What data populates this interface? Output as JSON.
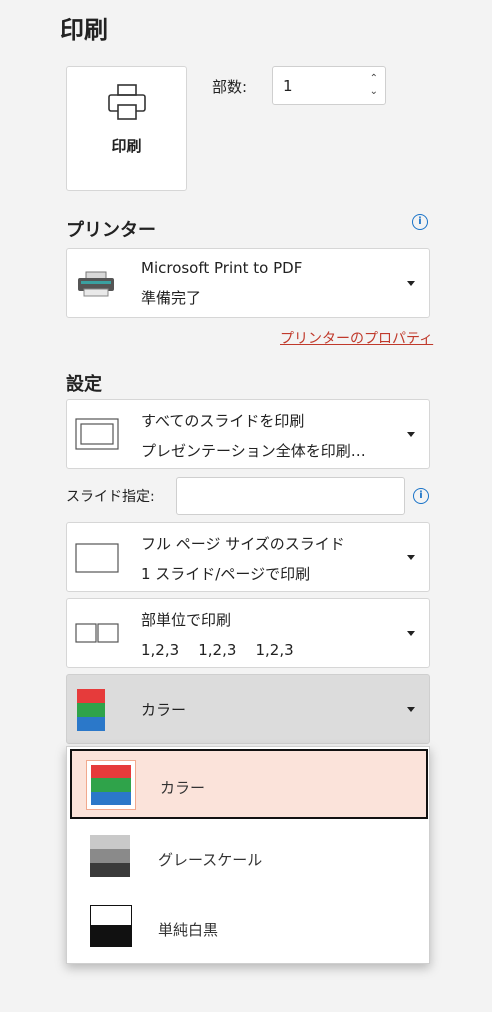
{
  "section": {
    "title": "印刷"
  },
  "print_button": {
    "label": "印刷"
  },
  "copies": {
    "label": "部数:",
    "value": "1"
  },
  "printer": {
    "heading": "プリンター",
    "name": "Microsoft Print to PDF",
    "status": "準備完了",
    "properties_link": "プリンターのプロパティ"
  },
  "settings": {
    "heading": "設定",
    "slides_range": {
      "line1": "すべてのスライドを印刷",
      "line2": "プレゼンテーション全体を印刷…"
    },
    "slide_spec_label": "スライド指定:",
    "slide_spec_value": "",
    "layout": {
      "line1": "フル ページ サイズのスライド",
      "line2": "1 スライド/ページで印刷"
    },
    "collate": {
      "line1": "部単位で印刷",
      "line2": "1,2,3    1,2,3    1,2,3"
    },
    "color": {
      "selected": "カラー"
    }
  },
  "color_menu": {
    "items": [
      {
        "label": "カラー",
        "selected": true
      },
      {
        "label": "グレースケール",
        "selected": false
      },
      {
        "label": "単純白黒",
        "selected": false
      }
    ]
  },
  "colors": {
    "accent_link": "#c0392b",
    "info": "#1a73c8",
    "selected_bg": "#fbe3da"
  }
}
